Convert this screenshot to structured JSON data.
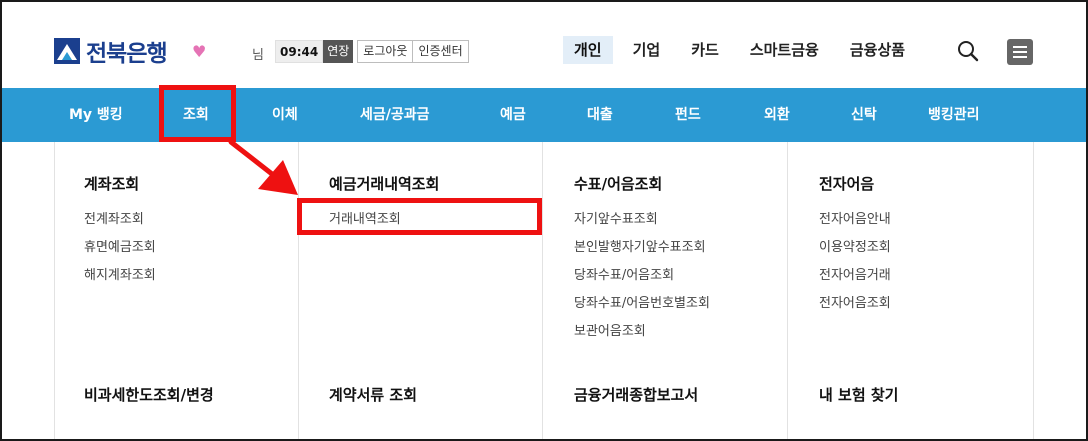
{
  "brand": {
    "logo_text": "전북은행",
    "accent": "#1b3f8e"
  },
  "session": {
    "user_suffix": "님",
    "timer": "09:44",
    "extend_label": "연장",
    "logout_label": "로그아웃",
    "cert_center_label": "인증센터"
  },
  "top_nav": {
    "items": [
      {
        "label": "개인",
        "active": true
      },
      {
        "label": "기업"
      },
      {
        "label": "카드"
      },
      {
        "label": "스마트금융"
      },
      {
        "label": "금융상품"
      }
    ]
  },
  "main_nav": {
    "bg_color": "#2b9ad3",
    "items": [
      {
        "label": "My 뱅킹"
      },
      {
        "label": "조회",
        "highlighted": true
      },
      {
        "label": "이체"
      },
      {
        "label": "세금/공과금"
      },
      {
        "label": "예금"
      },
      {
        "label": "대출"
      },
      {
        "label": "펀드"
      },
      {
        "label": "외환"
      },
      {
        "label": "신탁"
      },
      {
        "label": "뱅킹관리"
      }
    ]
  },
  "mega_menu": {
    "columns": [
      {
        "sections": [
          {
            "title": "계좌조회",
            "items": [
              "전계좌조회",
              "휴면예금조회",
              "해지계좌조회"
            ]
          },
          {
            "title": "비과세한도조회/변경",
            "items": []
          }
        ]
      },
      {
        "sections": [
          {
            "title": "예금거래내역조회",
            "items": [
              "거래내역조회"
            ]
          },
          {
            "title": "계약서류 조회",
            "items": []
          }
        ]
      },
      {
        "sections": [
          {
            "title": "수표/어음조회",
            "items": [
              "자기앞수표조회",
              "본인발행자기앞수표조회",
              "당좌수표/어음조회",
              "당좌수표/어음번호별조회",
              "보관어음조회"
            ]
          },
          {
            "title": "금융거래종합보고서",
            "items": []
          }
        ]
      },
      {
        "sections": [
          {
            "title": "전자어음",
            "items": [
              "전자어음안내",
              "이용약정조회",
              "전자어음거래",
              "전자어음조회"
            ]
          },
          {
            "title": "내 보험 찾기",
            "items": []
          }
        ]
      }
    ]
  },
  "annotation": {
    "color": "#ee1111"
  }
}
